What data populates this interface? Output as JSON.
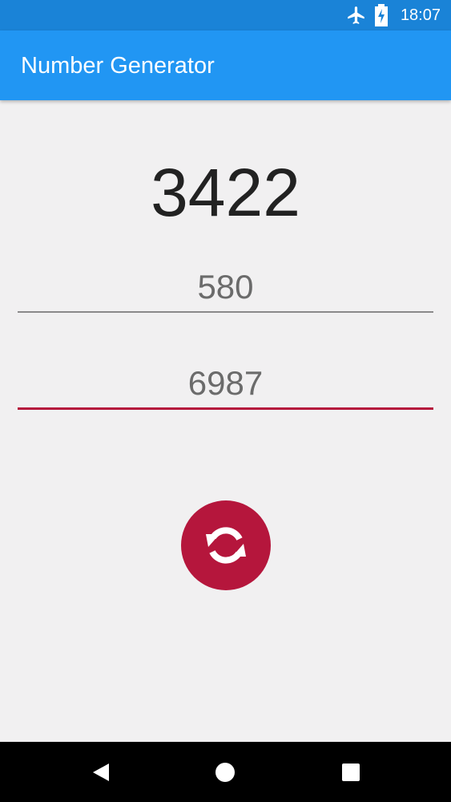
{
  "status_bar": {
    "time": "18:07",
    "icons": [
      "airplane-mode-icon",
      "battery-charging-icon"
    ]
  },
  "app_bar": {
    "title": "Number Generator"
  },
  "main": {
    "result": "3422",
    "min_field": {
      "value": "580"
    },
    "max_field": {
      "value": "6987"
    },
    "generate_button": {
      "icon": "refresh-icon"
    }
  },
  "nav_bar": {
    "icons": [
      "back-icon",
      "home-icon",
      "recents-icon"
    ]
  },
  "colors": {
    "status_bar": "#1a83d7",
    "app_bar": "#2196f3",
    "accent": "#b5163c",
    "background": "#f1f0f1"
  }
}
